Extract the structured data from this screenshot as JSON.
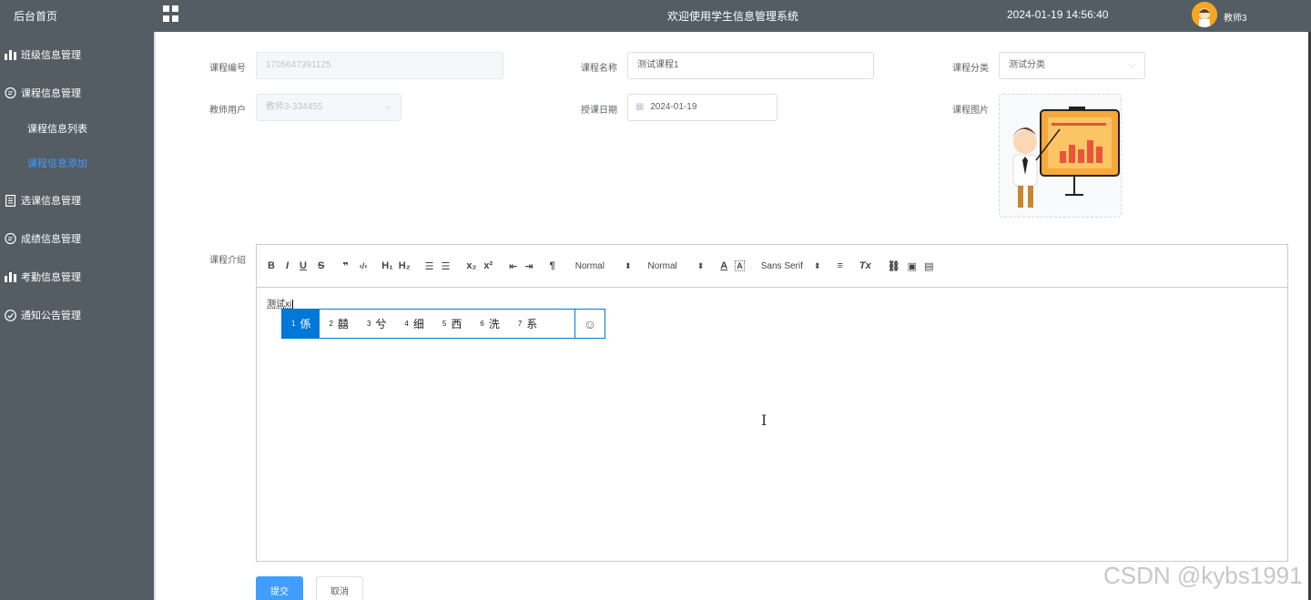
{
  "sidebar": {
    "home": "后台首页",
    "items": [
      {
        "label": "班级信息管理",
        "icon": "bar-chart-icon"
      },
      {
        "label": "课程信息管理",
        "icon": "chat-icon"
      },
      {
        "label": "选课信息管理",
        "icon": "document-icon"
      },
      {
        "label": "成绩信息管理",
        "icon": "chat-icon"
      },
      {
        "label": "考勤信息管理",
        "icon": "bar-chart-icon"
      },
      {
        "label": "通知公告管理",
        "icon": "check-circle-icon"
      }
    ],
    "sub": [
      {
        "label": "课程信息列表"
      },
      {
        "label": "课程信息添加",
        "active": true
      }
    ]
  },
  "header": {
    "title": "欢迎使用学生信息管理系统",
    "datetime": "2024-01-19 14:56:40",
    "user": "教师3"
  },
  "form": {
    "course_no": {
      "label": "课程编号",
      "value": "1705647391125"
    },
    "course_name": {
      "label": "课程名称",
      "value": "测试课程1"
    },
    "course_category": {
      "label": "课程分类",
      "value": "测试分类"
    },
    "teacher_user": {
      "label": "教师用户",
      "value": "教师3-334455"
    },
    "date": {
      "label": "授课日期",
      "value": "2024-01-19"
    },
    "image": {
      "label": "课程图片"
    },
    "intro": {
      "label": "课程介绍"
    }
  },
  "editor": {
    "toolbar": {
      "bold": "B",
      "italic": "I",
      "underline": "U",
      "strike": "S",
      "quote": "❞",
      "code": "‹/›",
      "h1": "H₁",
      "h2": "H₂",
      "ordered": "☰",
      "bullet": "☰",
      "sub": "x₂",
      "sup": "x²",
      "outdent": "⇤",
      "indent": "⇥",
      "direction": "¶",
      "size": "Normal",
      "header": "Normal",
      "color": "A",
      "bg": "A",
      "font": "Sans Serif",
      "align": "≡",
      "clean": "Tx",
      "link": "⛓",
      "image": "▣",
      "video": "▤"
    },
    "content": "测试xi",
    "ime_candidates": [
      {
        "num": "1",
        "char": "係"
      },
      {
        "num": "2",
        "char": "囍"
      },
      {
        "num": "3",
        "char": "兮"
      },
      {
        "num": "4",
        "char": "细"
      },
      {
        "num": "5",
        "char": "西"
      },
      {
        "num": "6",
        "char": "洗"
      },
      {
        "num": "7",
        "char": "系"
      }
    ],
    "ime_emoji": "☺"
  },
  "buttons": {
    "submit": "提交",
    "cancel": "取消"
  },
  "watermark": "CSDN @kybs1991",
  "colors": {
    "sidebar": "#545c64",
    "primary": "#409eff",
    "active": "#409eff",
    "ime": "#0078d7"
  }
}
